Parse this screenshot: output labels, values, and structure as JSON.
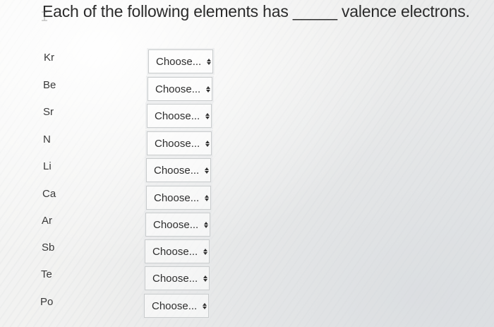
{
  "question": {
    "text": "Each of the following elements has _____ valence electrons."
  },
  "rows": [
    {
      "element": "Kr",
      "selected": "Choose..."
    },
    {
      "element": "Be",
      "selected": "Choose..."
    },
    {
      "element": "Sr",
      "selected": "Choose..."
    },
    {
      "element": "N",
      "selected": "Choose..."
    },
    {
      "element": "Li",
      "selected": "Choose..."
    },
    {
      "element": "Ca",
      "selected": "Choose..."
    },
    {
      "element": "Ar",
      "selected": "Choose..."
    },
    {
      "element": "Sb",
      "selected": "Choose..."
    },
    {
      "element": "Te",
      "selected": "Choose..."
    },
    {
      "element": "Po",
      "selected": "Choose..."
    }
  ],
  "icons": {
    "select_arrow": "up-down-chevron-icon",
    "cursor": "text-cursor-icon"
  }
}
